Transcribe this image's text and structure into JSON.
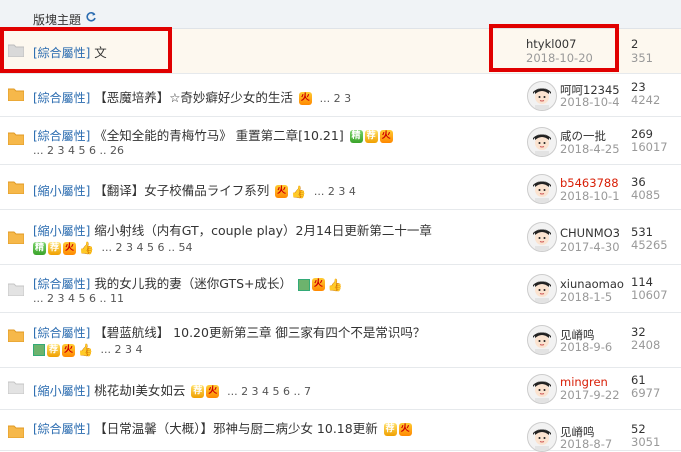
{
  "header": {
    "title": "版塊主題"
  },
  "threads": [
    {
      "category": "[綜合屬性]",
      "title": "文",
      "pages": "",
      "author": "htykl007",
      "date": "2018-10-20",
      "replies": "2",
      "views": "351"
    },
    {
      "category": "[綜合屬性]",
      "title": "【恶魔培养】☆奇妙癖好少女的生活",
      "pages": "... 2  3",
      "author": "呵呵12345",
      "date": "2018-10-4",
      "replies": "23",
      "views": "4242"
    },
    {
      "category": "[綜合屬性]",
      "title": "《全知全能的青梅竹马》 重置第二章[10.21]",
      "pages": "... 2  3  4  5  6 .. 26",
      "author": "咸の一批",
      "date": "2018-4-25",
      "replies": "269",
      "views": "16017"
    },
    {
      "category": "[縮小屬性]",
      "title": "【翻译】女子校備品ライフ系列",
      "pages": "... 2  3  4",
      "author": "b5463788",
      "date": "2018-10-1",
      "replies": "36",
      "views": "4085"
    },
    {
      "category": "[縮小屬性]",
      "title": "缩小射线（内有GT，couple play）2月14日更新第二十一章",
      "pages": "... 2  3  4  5  6 .. 54",
      "author": "CHUNMO3",
      "date": "2017-4-30",
      "replies": "531",
      "views": "45265"
    },
    {
      "category": "[綜合屬性]",
      "title": "我的女儿我的妻（迷你GTS+成长）",
      "pages": "... 2  3  4  5  6 .. 11",
      "author": "xiunaomao",
      "date": "2018-1-5",
      "replies": "114",
      "views": "10607"
    },
    {
      "category": "[綜合屬性]",
      "title": "【碧蓝航线】 10.20更新第三章 御三家有四个不是常识吗？",
      "pages": "... 2  3  4",
      "author": "见嵴鸣",
      "date": "2018-9-6",
      "replies": "32",
      "views": "2408"
    },
    {
      "category": "[縮小屬性]",
      "title": "桃花劫I美女如云",
      "pages": "... 2  3  4  5  6 .. 7",
      "author": "mingren",
      "date": "2017-9-22",
      "replies": "61",
      "views": "6977"
    },
    {
      "category": "[綜合屬性]",
      "title": "【日常温馨（大概）】邪神与厨二病少女 10.18更新",
      "pages": "",
      "author": "见嵴鸣",
      "date": "2018-8-7",
      "replies": "52",
      "views": "3051"
    }
  ],
  "colors": {
    "highlight_box": "#e00000",
    "link": "#2b6cb0",
    "author_red": "#d81e06"
  }
}
